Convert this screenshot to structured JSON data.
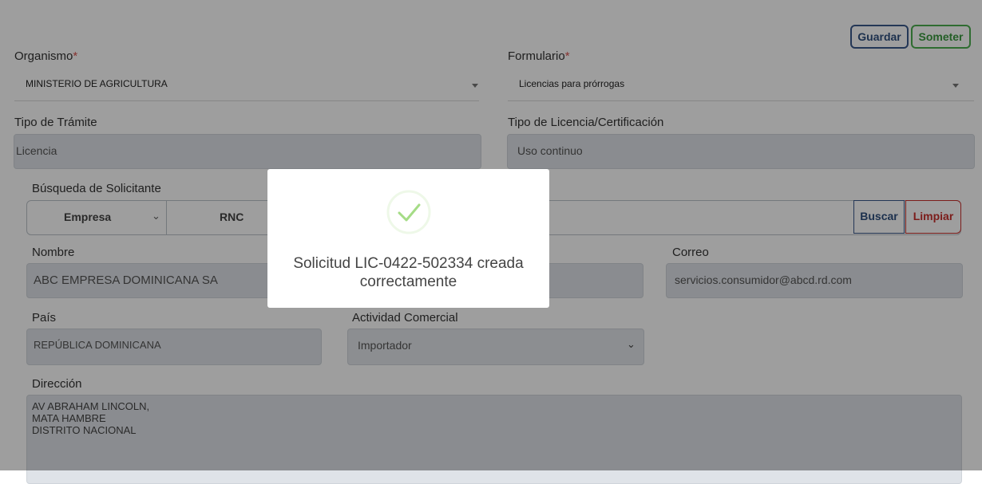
{
  "toolbar": {
    "save_label": "Guardar",
    "submit_label": "Someter"
  },
  "form": {
    "organismo": {
      "label": "Organismo",
      "required": "*",
      "value": "MINISTERIO DE AGRICULTURA"
    },
    "formulario": {
      "label": "Formulario",
      "required": "*",
      "value": "Licencias para prórrogas"
    },
    "tipo_tramite": {
      "label": "Tipo de Trámite",
      "value": "Licencia"
    },
    "tipo_licencia": {
      "label": "Tipo de Licencia/Certificación",
      "value": "Uso continuo"
    }
  },
  "search": {
    "section_label": "Búsqueda de Solicitante",
    "type_value": "Empresa",
    "id_type_label": "RNC",
    "buscar_label": "Buscar",
    "limpiar_label": "Limpiar"
  },
  "applicant": {
    "nombre_label": "Nombre",
    "nombre_value": "ABC EMPRESA DOMINICANA SA",
    "correo_label": "Correo",
    "correo_value": "servicios.consumidor@abcd.rd.com",
    "pais_label": "País",
    "pais_value": "REPÚBLICA DOMINICANA",
    "actividad_label": "Actividad Comercial",
    "actividad_value": "Importador",
    "direccion_label": "Dirección",
    "direccion_lines": [
      "AV ABRAHAM LINCOLN,",
      "MATA HAMBRE",
      "DISTRITO NACIONAL"
    ]
  },
  "modal": {
    "message_line1": "Solicitud LIC-0422-502334 creada",
    "message_line2": "correctamente",
    "success_color": "#a5dc86"
  },
  "colors": {
    "save_border": "#3a5a8c",
    "save_text": "#2f4f7f",
    "submit_border": "#4caf50",
    "submit_text": "#3a9a40",
    "limpiar_border": "#c9302c",
    "limpiar_text": "#c9302c"
  }
}
